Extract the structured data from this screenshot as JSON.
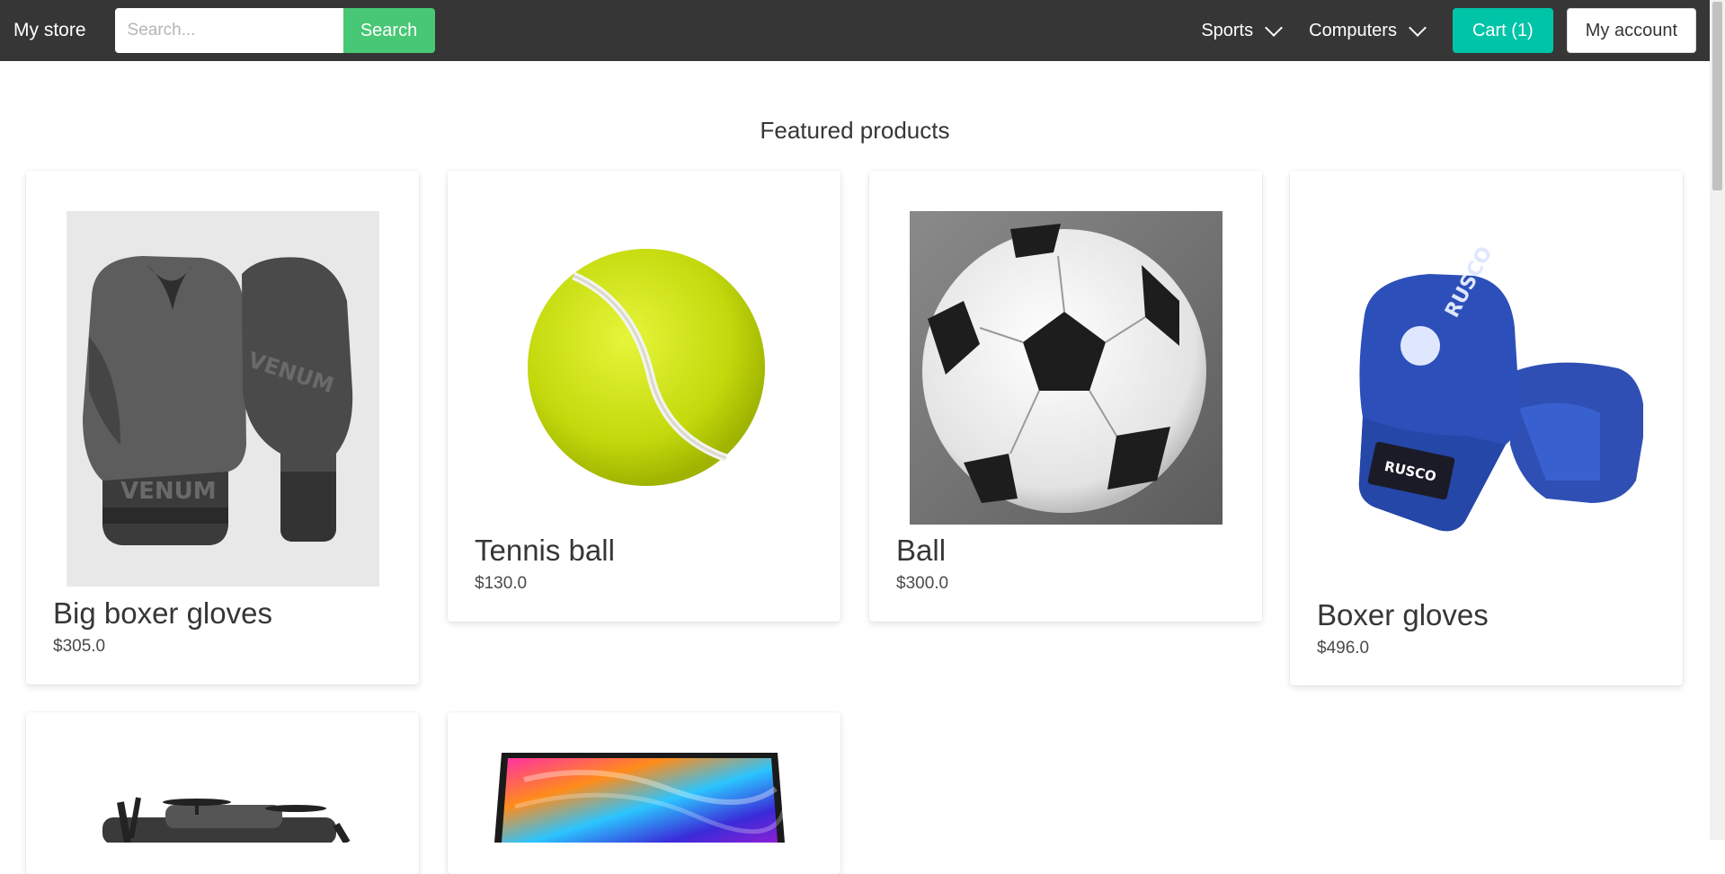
{
  "navbar": {
    "brand": "My store",
    "search_placeholder": "Search...",
    "search_button": "Search",
    "menu": [
      {
        "label": "Sports"
      },
      {
        "label": "Computers"
      }
    ],
    "cart_label": "Cart (1)",
    "account_label": "My account",
    "colors": {
      "bar": "#363636",
      "search_button": "#48c774",
      "cart_button": "#00c4a7"
    }
  },
  "main": {
    "heading": "Featured products",
    "products": [
      {
        "name": "Big boxer gloves",
        "price": "$305.0",
        "image": "black-grey-boxing-gloves-image"
      },
      {
        "name": "Tennis ball",
        "price": "$130.0",
        "image": "tennis-ball-image"
      },
      {
        "name": "Ball",
        "price": "$300.0",
        "image": "soccer-ball-image"
      },
      {
        "name": "Boxer gloves",
        "price": "$496.0",
        "image": "blue-boxing-gloves-image"
      },
      {
        "name": "",
        "price": "",
        "image": "drone-image"
      },
      {
        "name": "",
        "price": "",
        "image": "laptop-image"
      }
    ]
  }
}
